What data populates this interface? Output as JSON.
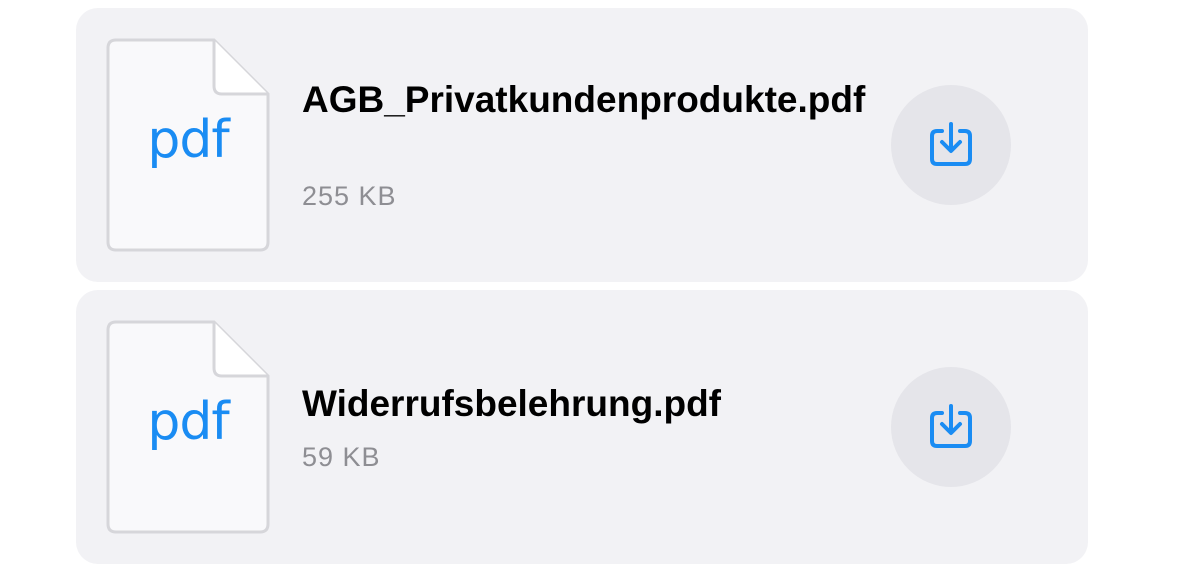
{
  "attachments": [
    {
      "file_type": "pdf",
      "name": "AGB_Privatkundenprodukte.pdf",
      "size": "255 KB",
      "icon": "pdf-file-icon",
      "action_icon": "download-icon"
    },
    {
      "file_type": "pdf",
      "name": "Widerrufsbelehrung.pdf",
      "size": "59 KB",
      "icon": "pdf-file-icon",
      "action_icon": "download-icon"
    }
  ],
  "colors": {
    "card_background": "#f2f2f5",
    "accent": "#1a8cf3",
    "secondary_text": "#8e8e93",
    "button_background": "#e5e5ea"
  }
}
